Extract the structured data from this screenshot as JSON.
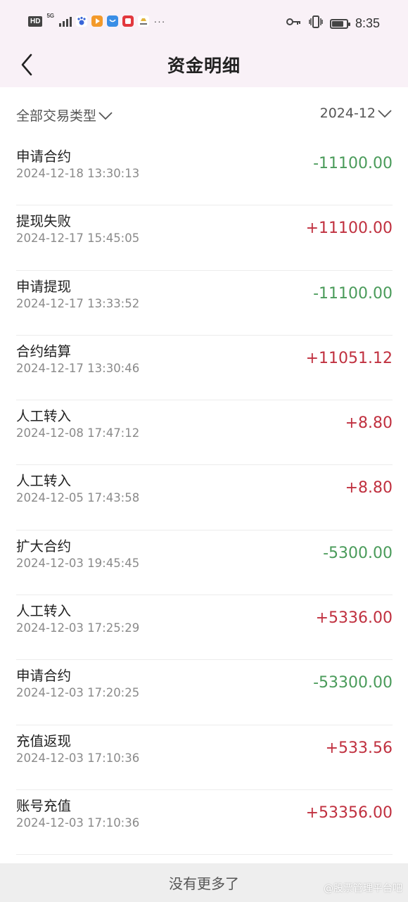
{
  "status_bar": {
    "hd_label": "HD",
    "network_label": "5G",
    "time": "8:35",
    "battery_level": 0.72,
    "icons": [
      "hd-icon",
      "signal-icon",
      "paw-app-icon",
      "video-app-icon",
      "chat-app-icon",
      "red-app-icon",
      "lamp-app-icon",
      "more-dots-icon",
      "key-icon",
      "vibrate-icon",
      "battery-icon"
    ],
    "more_dots": "···"
  },
  "header": {
    "title": "资金明细",
    "back_icon": "chevron-left-icon"
  },
  "filters": {
    "type_label": "全部交易类型",
    "month_label": "2024-12",
    "dropdown_icon": "chevron-down-icon"
  },
  "colors": {
    "negative": "#4a9b5a",
    "positive": "#c0303f",
    "header_bg": "#f9f1f7"
  },
  "transactions": [
    {
      "name": "申请合约",
      "time": "2024-12-18 13:30:13",
      "amount": "-11100.00",
      "sign": "neg"
    },
    {
      "name": "提现失败",
      "time": "2024-12-17 15:45:05",
      "amount": "+11100.00",
      "sign": "pos"
    },
    {
      "name": "申请提现",
      "time": "2024-12-17 13:33:52",
      "amount": "-11100.00",
      "sign": "neg"
    },
    {
      "name": "合约结算",
      "time": "2024-12-17 13:30:46",
      "amount": "+11051.12",
      "sign": "pos"
    },
    {
      "name": "人工转入",
      "time": "2024-12-08 17:47:12",
      "amount": "+8.80",
      "sign": "pos"
    },
    {
      "name": "人工转入",
      "time": "2024-12-05 17:43:58",
      "amount": "+8.80",
      "sign": "pos"
    },
    {
      "name": "扩大合约",
      "time": "2024-12-03 19:45:45",
      "amount": "-5300.00",
      "sign": "neg"
    },
    {
      "name": "人工转入",
      "time": "2024-12-03 17:25:29",
      "amount": "+5336.00",
      "sign": "pos"
    },
    {
      "name": "申请合约",
      "time": "2024-12-03 17:20:25",
      "amount": "-53300.00",
      "sign": "neg"
    },
    {
      "name": "充值返现",
      "time": "2024-12-03 17:10:36",
      "amount": "+533.56",
      "sign": "pos"
    },
    {
      "name": "账号充值",
      "time": "2024-12-03 17:10:36",
      "amount": "+53356.00",
      "sign": "pos"
    }
  ],
  "footer": {
    "no_more_text": "没有更多了",
    "watermark": "@股票管理平台吧"
  }
}
